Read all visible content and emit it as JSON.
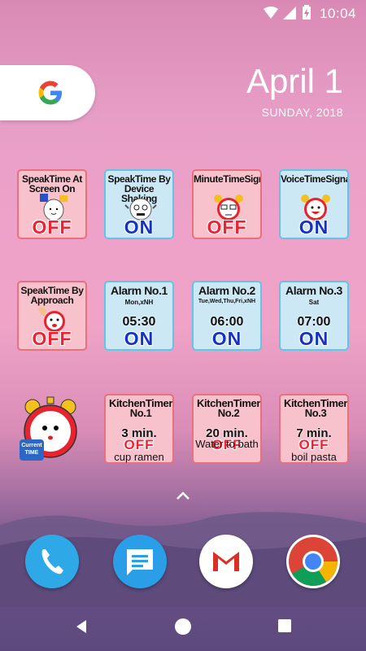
{
  "status_bar": {
    "time": "10:04"
  },
  "date_widget": {
    "date": "April 1",
    "weekday_year": "SUNDAY, 2018"
  },
  "widgets": {
    "speak_screen_on": {
      "title": "SpeakTime At Screen On",
      "state": "OFF"
    },
    "speak_shaking": {
      "title": "SpeakTime By Device Shaking",
      "state": "ON"
    },
    "minute_signal": {
      "title": "MinuteTimeSignal",
      "state": "OFF"
    },
    "voice_signal": {
      "title": "VoiceTimeSignal",
      "state": "ON"
    },
    "speak_approach": {
      "title": "SpeakTime By Approach",
      "state": "OFF"
    },
    "alarm1": {
      "title": "Alarm No.1",
      "days": "Mon,xNH",
      "time": "05:30",
      "state": "ON"
    },
    "alarm2": {
      "title": "Alarm No.2",
      "days": "Tue,Wed,Thu,Fri,xNH",
      "time": "06:00",
      "state": "ON"
    },
    "alarm3": {
      "title": "Alarm No.3",
      "days": "Sat",
      "time": "07:00",
      "state": "ON"
    },
    "current_time_badge": "Current TIME",
    "timer1": {
      "title": "KitchenTimer No.1",
      "value": "3 min.",
      "state": "OFF",
      "label": "cup ramen"
    },
    "timer2": {
      "title": "KitchenTimer No.2",
      "value": "20 min.",
      "state": "OFF",
      "label": "Water to bath"
    },
    "timer3": {
      "title": "KitchenTimer No.3",
      "value": "7 min.",
      "state": "OFF",
      "label": "boil pasta"
    }
  },
  "dock": [
    "phone-app",
    "messages-app",
    "gmail-app",
    "chrome-app"
  ],
  "colors": {
    "off_border": "#ea6f7f",
    "on_border": "#62c4e7",
    "off_text": "#ee2233",
    "on_text": "#1531c6"
  }
}
